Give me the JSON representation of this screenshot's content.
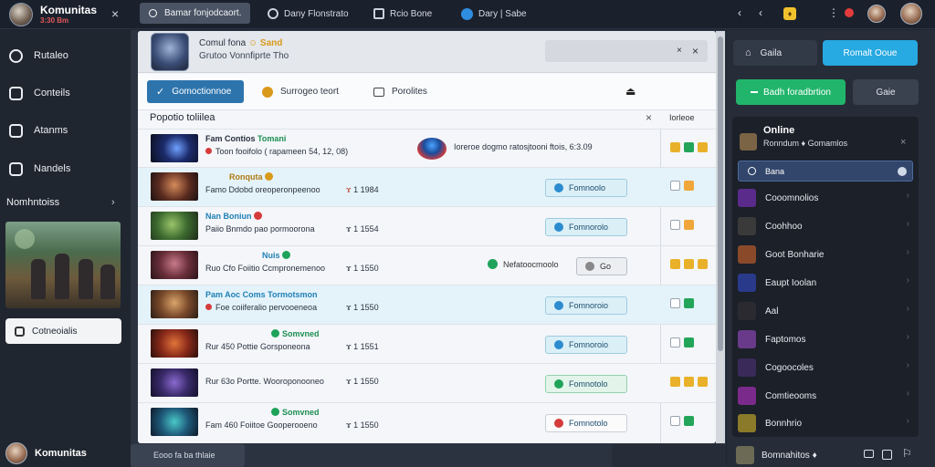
{
  "topbar": {
    "brand_title": "Komunitas",
    "brand_subtitle": "3:30 Bm",
    "close": "×",
    "search_text": "Bamar fonjodcaort.",
    "items": [
      "Dany Flonstrato",
      "Rcio Bone",
      "Dary | Sabe"
    ],
    "right_glyphs": [
      "‹",
      "‹",
      "⋮",
      "‹"
    ],
    "coin_label": "♦"
  },
  "leftnav": {
    "items": [
      "Rutaleo",
      "Conteils",
      "Atanms",
      "Nandels"
    ],
    "section_title": "Nomhntoiss",
    "section_chevron": "›",
    "button_label": "Cotneoialis",
    "profile_name": "Komunitas"
  },
  "panel": {
    "header_title": "Comul fona",
    "header_badge": "☺ Sand",
    "header_subtitle": "Grutoo Vonnfiprte Tho",
    "header_close_1": "×",
    "header_close_2": "×",
    "tabs": [
      "Gomoctionnoe",
      "Surrogeo teort",
      "Porolites"
    ],
    "section_title": "Popotio toliilea",
    "section_close": "×",
    "section_right": "Iorleoe",
    "rows": [
      {
        "title": "Fam Contios",
        "title2": "Tomani",
        "sub": "Toon fooifolo ( rapameen 54,",
        "num": "12, 08)",
        "mid_text": "Ioreroe dogmo ratosjtooni ftois,",
        "mid_num": "6:3.09"
      },
      {
        "title": "Ronquta",
        "sub": "Famo Ddobd oreoperonpeenoo",
        "num": "1 1984",
        "pill": "Fomnoolo"
      },
      {
        "title": "Nan Boniun",
        "sub": "Paiio Bnmdo pao pormoorona",
        "num": "1 1554",
        "pill": "Fomnorolo"
      },
      {
        "title": "Nuis",
        "sub": "Ruo Cfo Foiitio Ccmpronemenoo",
        "num": "1 1550",
        "mid_text": "Nefatoocmoolo",
        "pill": "Go"
      },
      {
        "title": "Pam Aoc Coms Tormotsmon",
        "sub": "Foe coiiferalio pervooeneoa",
        "num": "1 1550",
        "pill": "Fomnoroio"
      },
      {
        "title": "Somvned",
        "sub": "Rur 450 Pottie Gorsponeona",
        "num": "1 1551",
        "pill": "Fomnoroio"
      },
      {
        "title": "",
        "sub": "Rur 63o Portte. Wooroponooneo",
        "num": "1 1550",
        "pill": "Fomnotolo"
      },
      {
        "title": "Somvned",
        "sub": "Fam 460 Foiitoe Gooperooeno",
        "num": "1 1550",
        "pill": "Fomnotolo"
      }
    ],
    "bottom_search": "Eooo fa ba thlaie"
  },
  "rightpanel": {
    "btn1": "Gaila",
    "btn2": "Romalt Ooue",
    "btn3": "Badh foradbrtion",
    "btn4": "Gaie",
    "online_title": "Online",
    "online_sub": "Ronndum  ♦  Gomamlos",
    "online_close": "×",
    "search_value": "Bana",
    "users": [
      "Cooomnolios",
      "Coohhoo",
      "Goot Bonharie",
      "Eaupt Ioolan",
      "Aal",
      "Faptomos",
      "Cogoocoles",
      "Comtieooms",
      "Bonnhrio"
    ],
    "footer_name": "Bomnahitos ♦"
  },
  "colors": {
    "accent_blue": "#27a9e1",
    "accent_green": "#21b56b",
    "tab_active": "#2d74ad",
    "background": "#1e2533"
  }
}
